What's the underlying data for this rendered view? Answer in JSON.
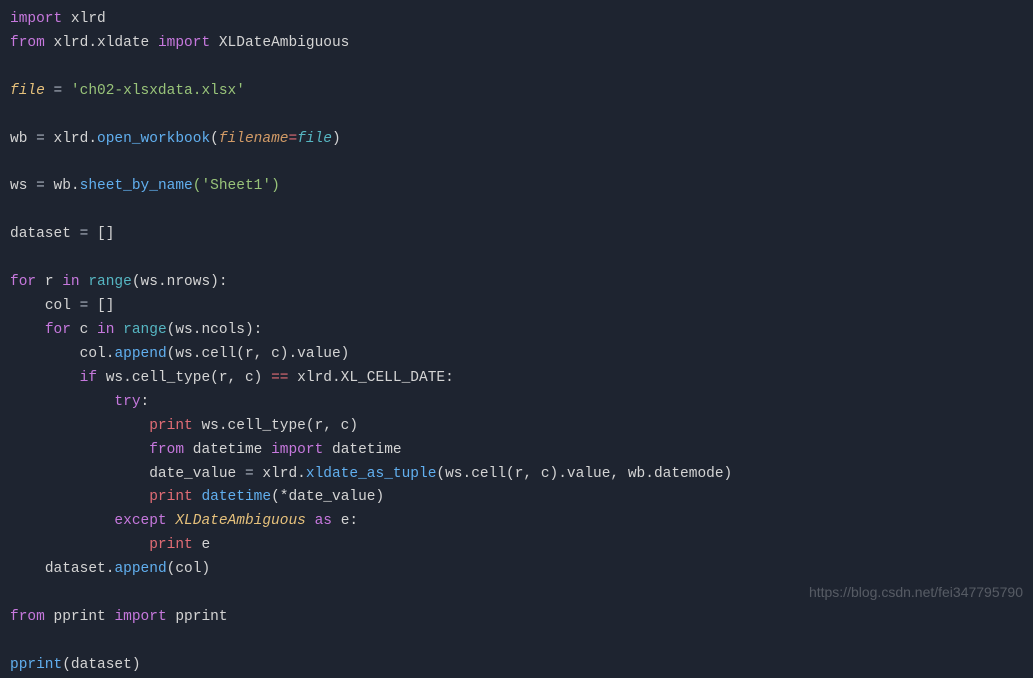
{
  "code": {
    "l1_import": "import",
    "l1_mod": "xlrd",
    "l2_from": "from",
    "l2_mod": "xlrd.xldate",
    "l2_import": "import",
    "l2_name": "XLDateAmbiguous",
    "l4_var": "file",
    "l4_eq": " = ",
    "l4_str": "'ch02-xlsxdata.xlsx'",
    "l6_lhs": "wb",
    "l6_eq": " = ",
    "l6_obj": "xlrd",
    "l6_dot": ".",
    "l6_fn": "open_workbook",
    "l6_open": "(",
    "l6_param": "filename",
    "l6_peq": "=",
    "l6_paramval": "file",
    "l6_close": ")",
    "l8_lhs": "ws",
    "l8_eq": " = ",
    "l8_obj": "wb",
    "l8_dot": ".",
    "l8_fn": "sheet_by_name",
    "l8_args": "('Sheet1')",
    "l10_lhs": "dataset",
    "l10_eq": " = ",
    "l10_val": "[]",
    "l12_for": "for",
    "l12_var": "r",
    "l12_in": "in",
    "l12_range": "range",
    "l12_args": "(ws.nrows):",
    "l13_ind": "    ",
    "l13_lhs": "col",
    "l13_eq": " = ",
    "l13_val": "[]",
    "l14_ind": "    ",
    "l14_for": "for",
    "l14_var": "c",
    "l14_in": "in",
    "l14_range": "range",
    "l14_args": "(ws.ncols):",
    "l15_ind": "        ",
    "l15_obj": "col",
    "l15_dot": ".",
    "l15_fn": "append",
    "l15_args": "(ws.cell(r, c).value)",
    "l16_ind": "        ",
    "l16_if": "if",
    "l16_expr_a": " ws.cell_type(r, c) ",
    "l16_eq": "==",
    "l16_expr_b": " xlrd.XL_CELL_DATE:",
    "l17_ind": "            ",
    "l17_try": "try",
    "l17_colon": ":",
    "l18_ind": "                ",
    "l18_print": "print",
    "l18_args": " ws.cell_type(r, c)",
    "l19_ind": "                ",
    "l19_from": "from",
    "l19_mod": "datetime",
    "l19_import": "import",
    "l19_name": "datetime",
    "l20_ind": "                ",
    "l20_lhs": "date_value",
    "l20_eq": " = ",
    "l20_obj": "xlrd",
    "l20_dot": ".",
    "l20_fn": "xldate_as_tuple",
    "l20_args": "(ws.cell(r, c).value, wb.datemode)",
    "l21_ind": "                ",
    "l21_print": "print",
    "l21_fn": " datetime",
    "l21_args": "(*date_value)",
    "l22_ind": "            ",
    "l22_except": "except",
    "l22_cls": "XLDateAmbiguous",
    "l22_as": "as",
    "l22_var": "e",
    "l22_colon": ":",
    "l23_ind": "                ",
    "l23_print": "print",
    "l23_var": " e",
    "l24_ind": "    ",
    "l24_obj": "dataset",
    "l24_dot": ".",
    "l24_fn": "append",
    "l24_args": "(col)",
    "l26_from": "from",
    "l26_mod": "pprint",
    "l26_import": "import",
    "l26_name": "pprint",
    "l28_fn": "pprint",
    "l28_args": "(dataset)"
  },
  "watermark": "https://blog.csdn.net/fei347795790"
}
